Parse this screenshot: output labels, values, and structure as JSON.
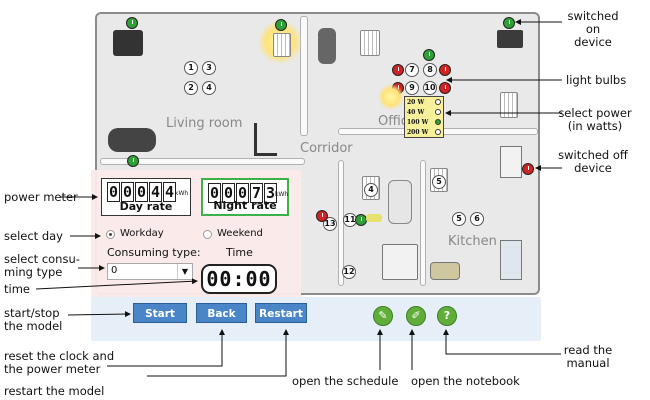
{
  "labels": {
    "living_room": "Living room",
    "corridor": "Corridor",
    "office": "Office",
    "kitchen": "Kitchen"
  },
  "meters": {
    "day_digits": [
      "0",
      "0",
      "0",
      "4",
      "4"
    ],
    "day_unit": "kWh",
    "day_label": "Day rate",
    "night_digits": [
      "0",
      "0",
      "0",
      "7",
      "3"
    ],
    "night_unit": "kWh",
    "night_label": "Night rate"
  },
  "day_select": {
    "workday": "Workday",
    "weekend": "Weekend",
    "selected": "workday"
  },
  "consuming": {
    "label": "Consuming type:",
    "value": "0",
    "time_label": "Time",
    "time_value": "00:00"
  },
  "buttons": {
    "start": "Start",
    "back": "Back",
    "restart": "Restart"
  },
  "power_options": [
    "20",
    "40",
    "100",
    "200"
  ],
  "power_unit": "W",
  "power_selected": "100",
  "device_numbers": [
    "1",
    "2",
    "3",
    "4",
    "5",
    "6",
    "7",
    "8",
    "9",
    "10",
    "11",
    "12",
    "13"
  ],
  "callouts": {
    "switched_on": "switched on\ndevice",
    "light_bulbs": "light bulbs",
    "select_power": "select power\n(in watts)",
    "switched_off": "switched off\ndevice",
    "power_meter": "power meter",
    "select_day": "select day",
    "select_consuming": "select consu-\nming type",
    "time": "time",
    "start_stop": "start/stop\nthe model",
    "reset": "reset the clock and\nthe power meter",
    "restart": "restart the model",
    "schedule": "open the schedule",
    "notebook": "open the notebook",
    "manual": "read the\nmanual"
  }
}
